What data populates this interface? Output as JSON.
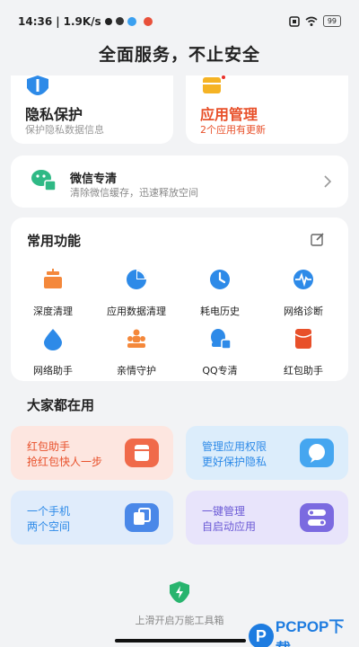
{
  "status": {
    "time": "14:36",
    "speed": "1.9K/s",
    "battery": "99"
  },
  "header": {
    "title": "全面服务，不止安全"
  },
  "top_cards": [
    {
      "title": "隐私保护",
      "subtitle": "保护隐私数据信息",
      "icon": "privacy-shield-icon",
      "title_color": "#222222"
    },
    {
      "title": "应用管理",
      "subtitle": "2个应用有更新",
      "icon": "app-manage-icon",
      "title_color": "#e8502a",
      "subtitle_color": "#e8502a"
    }
  ],
  "wechat": {
    "title": "微信专清",
    "subtitle": "清除微信缓存，迅速释放空间"
  },
  "common": {
    "title": "常用功能",
    "items": [
      {
        "label": "深度清理",
        "icon": "deep-clean-icon",
        "color": "#f4883b"
      },
      {
        "label": "应用数据清理",
        "icon": "app-data-pie-icon",
        "color": "#2d8ae8"
      },
      {
        "label": "耗电历史",
        "icon": "clock-icon",
        "color": "#2d8ae8"
      },
      {
        "label": "网络诊断",
        "icon": "network-pulse-icon",
        "color": "#2d8ae8"
      },
      {
        "label": "网络助手",
        "icon": "water-drop-icon",
        "color": "#2d8ae8"
      },
      {
        "label": "亲情守护",
        "icon": "family-icon",
        "color": "#f4883b"
      },
      {
        "label": "QQ专清",
        "icon": "qq-clean-icon",
        "color": "#2d8ae8"
      },
      {
        "label": "红包助手",
        "icon": "red-packet-icon",
        "color": "#e8502a"
      }
    ]
  },
  "popular": {
    "title": "大家都在用",
    "cards": [
      {
        "line1": "红包助手",
        "line2": "抢红包快人一步",
        "bg": "#fde6e0",
        "text_color": "#e8502a",
        "icon_color": "#f06a4a",
        "icon": "red-packet-icon"
      },
      {
        "line1": "管理应用权限",
        "line2": "更好保护隐私",
        "bg": "#dcedfb",
        "text_color": "#2d8ae8",
        "icon_color": "#45a6f0",
        "icon": "chat-bubble-icon"
      },
      {
        "line1": "一个手机",
        "line2": "两个空间",
        "bg": "#e0ecfb",
        "text_color": "#2d8ae8",
        "icon_color": "#4a88e8",
        "icon": "dual-space-icon"
      },
      {
        "line1": "一键管理",
        "line2": "自启动应用",
        "bg": "#e8e4fb",
        "text_color": "#6b5ad6",
        "icon_color": "#7b6ae0",
        "icon": "toggle-icon"
      }
    ]
  },
  "bottom": {
    "label": "上滑开启万能工具箱"
  },
  "watermark": {
    "text": "PCPOP下载"
  }
}
